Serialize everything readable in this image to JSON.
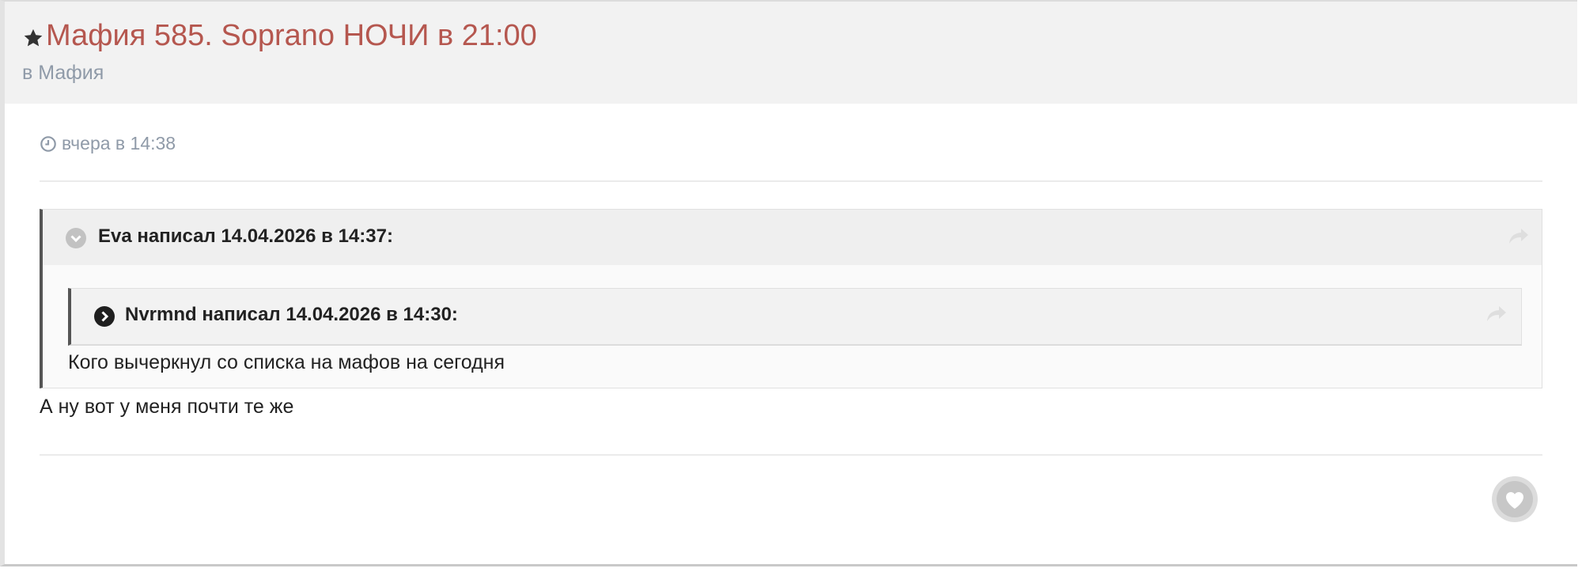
{
  "topic": {
    "title": "Мафия 585. Soprano НОЧИ в 21:00",
    "forum": "в Мафия"
  },
  "post": {
    "timestamp": "вчера в 14:38",
    "outer_quote": {
      "header": "Eva написал 14.04.2026 в 14:37:",
      "text": "Кого вычеркнул со списка на мафов на сегодня"
    },
    "inner_quote": {
      "header": "Nvrmnd написал 14.04.2026 в 14:30:"
    },
    "body": "А ну вот у меня почти те же"
  },
  "icons": {
    "title": "star-icon",
    "timestamp": "clock-icon",
    "outer_quote_toggle": "chevron-down-icon",
    "inner_quote_toggle": "chevron-right-icon",
    "share": "share-arrow-icon",
    "reaction": "heart-icon"
  },
  "colors": {
    "title": "#b5574f",
    "muted": "#8f9aa8",
    "header_bg": "#f2f2f2",
    "text": "#222222"
  }
}
